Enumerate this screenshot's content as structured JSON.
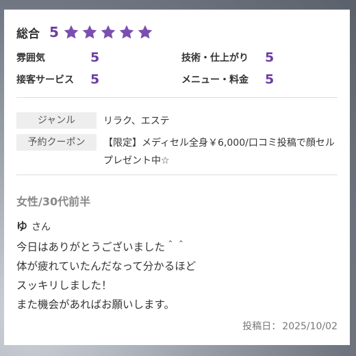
{
  "overall": {
    "label": "総合",
    "score": "5",
    "stars": 5,
    "star_color": "#7b4fb0"
  },
  "ratings": [
    {
      "label": "雰囲気",
      "value": "5"
    },
    {
      "label": "技術・仕上がり",
      "value": "5"
    },
    {
      "label": "接客サービス",
      "value": "5"
    },
    {
      "label": "メニュー・料金",
      "value": "5"
    }
  ],
  "info": {
    "genre_label": "ジャンル",
    "genre_value": "リラク、エステ",
    "coupon_label": "予約クーポン",
    "coupon_value": "【限定】メディセル全身￥6,000/口コミ投稿で顔セルプレゼント中☆"
  },
  "reviewer": {
    "profile": "女性/30代前半",
    "name": "ゆ",
    "honorific": "さん"
  },
  "review_body": [
    "今日はありがとうございました＾＾",
    "体が疲れていたんだなって分かるほど",
    "スッキリしました！",
    "また機会があればお願いします。"
  ],
  "posted": {
    "label": "投稿日：",
    "date": "2025/10/02"
  },
  "colors": {
    "accent": "#6b3fa0",
    "label_bg": "#eeeeee"
  }
}
